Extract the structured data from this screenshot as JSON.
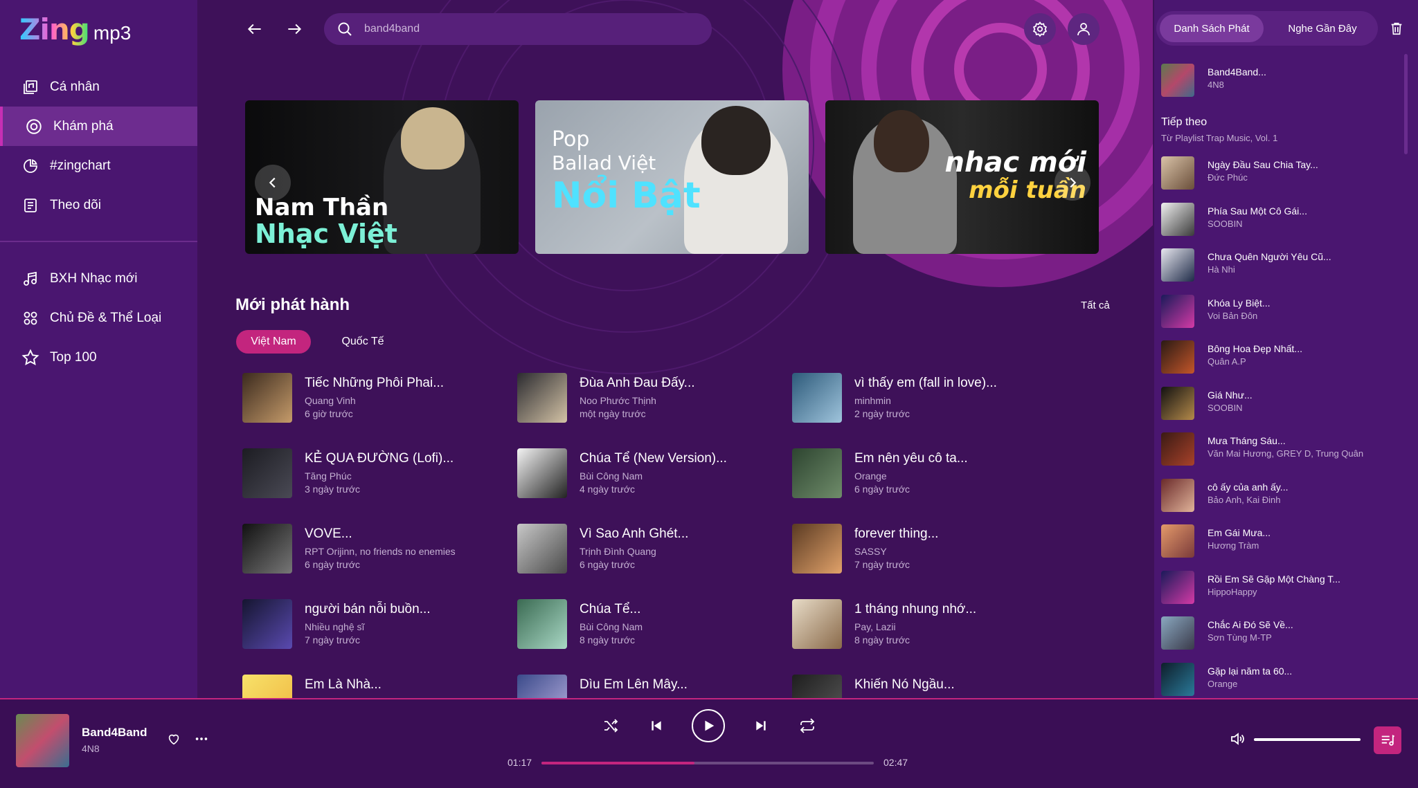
{
  "app": {
    "logo_main": "Zing",
    "logo_sub": "mp3"
  },
  "sidebar": {
    "items": [
      {
        "label": "Cá nhân",
        "icon": "library-icon"
      },
      {
        "label": "Khám phá",
        "icon": "disc-icon",
        "active": true
      },
      {
        "label": "#zingchart",
        "icon": "chart-icon"
      },
      {
        "label": "Theo dõi",
        "icon": "document-icon"
      }
    ],
    "items2": [
      {
        "label": "BXH Nhạc mới",
        "icon": "music-note-icon"
      },
      {
        "label": "Chủ Đề & Thể Loại",
        "icon": "grid-icon"
      },
      {
        "label": "Top 100",
        "icon": "star-icon"
      }
    ]
  },
  "search": {
    "value": "band4band"
  },
  "banners": [
    {
      "line1": "Nam Thần",
      "line2": "Nhạc Việt"
    },
    {
      "line1": "Pop",
      "line2": "Ballad Việt",
      "line3": "Nổi Bật"
    },
    {
      "line1": "nhac mới",
      "line2": "mỗi tuần"
    }
  ],
  "section": {
    "title": "Mới phát hành",
    "see_all": "Tất cả",
    "chips": [
      "Việt Nam",
      "Quốc Tế"
    ]
  },
  "songs": [
    {
      "title": "Tiếc Những Phôi Phai...",
      "artist": "Quang Vinh",
      "date": "6 giờ trước"
    },
    {
      "title": "Đùa Anh Đau Đấy...",
      "artist": "Noo Phước Thịnh",
      "date": "một ngày trước"
    },
    {
      "title": "vì thấy em (fall in love)...",
      "artist": "minhmin",
      "date": "2 ngày trước"
    },
    {
      "title": "KẺ QUA ĐƯỜNG (Lofi)...",
      "artist": "Tăng Phúc",
      "date": "3 ngày trước"
    },
    {
      "title": "Chúa Tể (New Version)...",
      "artist": "Bùi Công Nam",
      "date": "4 ngày trước"
    },
    {
      "title": "Em nên yêu cô ta...",
      "artist": "Orange",
      "date": "6 ngày trước"
    },
    {
      "title": "VOVE...",
      "artist": "RPT Orijinn, no friends no enemies",
      "date": "6 ngày trước"
    },
    {
      "title": "Vì Sao Anh Ghét...",
      "artist": "Trịnh Đình Quang",
      "date": "6 ngày trước"
    },
    {
      "title": "forever thing...",
      "artist": "SASSY",
      "date": "7 ngày trước"
    },
    {
      "title": "người bán nỗi buồn...",
      "artist": "Nhiều nghệ sĩ",
      "date": "7 ngày trước"
    },
    {
      "title": "Chúa Tể...",
      "artist": "Bùi Công Nam",
      "date": "8 ngày trước"
    },
    {
      "title": "1 tháng nhung nhớ...",
      "artist": "Pay, Lazii",
      "date": "8 ngày trước"
    },
    {
      "title": "Em Là Nhà...",
      "artist": "",
      "date": ""
    },
    {
      "title": "Dìu Em Lên Mây...",
      "artist": "",
      "date": ""
    },
    {
      "title": "Khiến Nó Ngầu...",
      "artist": "",
      "date": ""
    }
  ],
  "queue": {
    "tabs": [
      "Danh Sách Phát",
      "Nghe Gần Đây"
    ],
    "current": {
      "title": "Band4Band...",
      "artist": "4N8"
    },
    "next_label": "Tiếp theo",
    "next_sub": "Từ Playlist Trap Music, Vol. 1",
    "items": [
      {
        "title": "Ngày Đầu Sau Chia Tay...",
        "artist": "Đức Phúc"
      },
      {
        "title": "Phía Sau Một Cô Gái...",
        "artist": "SOOBIN"
      },
      {
        "title": "Chưa Quên Người Yêu Cũ...",
        "artist": "Hà Nhi"
      },
      {
        "title": "Khóa Ly Biệt...",
        "artist": "Voi Bản Đôn"
      },
      {
        "title": "Bông Hoa Đẹp Nhất...",
        "artist": "Quân A.P"
      },
      {
        "title": "Giá Như...",
        "artist": "SOOBIN"
      },
      {
        "title": "Mưa Tháng Sáu...",
        "artist": "Văn Mai Hương, GREY D, Trung Quân"
      },
      {
        "title": "cô ấy của anh ấy...",
        "artist": "Bảo Anh, Kai Đinh"
      },
      {
        "title": "Em Gái Mưa...",
        "artist": "Hương Tràm"
      },
      {
        "title": "Rồi Em Sẽ Gặp Một Chàng T...",
        "artist": "HippoHappy"
      },
      {
        "title": "Chắc Ai Đó Sẽ Về...",
        "artist": "Sơn Tùng M-TP"
      },
      {
        "title": "Gặp lại năm ta 60...",
        "artist": "Orange"
      }
    ]
  },
  "player": {
    "title": "Band4Band",
    "artist": "4N8",
    "current_time": "01:17",
    "total_time": "02:47",
    "progress": 0.46,
    "volume": 1.0
  },
  "colors": {
    "accent": "#c3257e",
    "sidebar": "#4a1670",
    "main_bg": "#3e1159",
    "player_bg": "#3a0e55"
  }
}
